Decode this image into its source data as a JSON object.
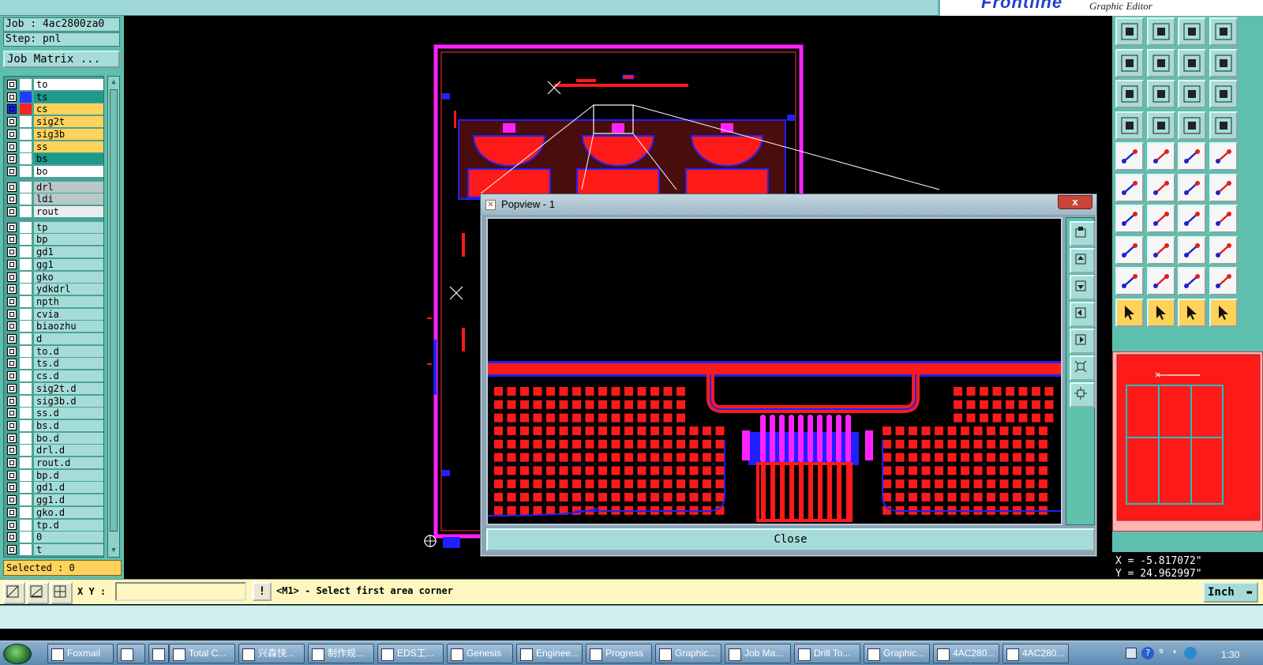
{
  "app": {
    "brand": "Frontline",
    "subtitle": "Graphic Editor"
  },
  "job": {
    "job_line": "Job : 4ac2800za0",
    "step_line": "Step: pnl",
    "matrix_button": "Job Matrix ..."
  },
  "layers": [
    {
      "name": "to",
      "bg": "#ffffff",
      "swatch": "#ffffff"
    },
    {
      "name": "ts",
      "bg": "#1d9a8c",
      "swatch": "#1f3cff"
    },
    {
      "name": "cs",
      "bg": "#ffd25c",
      "swatch": "#ff2020",
      "active": true
    },
    {
      "name": "sig2t",
      "bg": "#ffd25c",
      "swatch": "#ffffff"
    },
    {
      "name": "sig3b",
      "bg": "#ffd25c",
      "swatch": "#ffffff"
    },
    {
      "name": "ss",
      "bg": "#ffd25c",
      "swatch": "#ffffff"
    },
    {
      "name": "bs",
      "bg": "#1d9a8c",
      "swatch": "#ffffff"
    },
    {
      "name": "bo",
      "bg": "#ffffff",
      "swatch": "#ffffff"
    },
    {
      "name": "drl",
      "bg": "#b8c8c8",
      "swatch": "#ffffff",
      "gap": true
    },
    {
      "name": "ldi",
      "bg": "#b8c8c8",
      "swatch": "#ffffff"
    },
    {
      "name": "rout",
      "bg": "#e8eeee",
      "swatch": "#ffffff"
    },
    {
      "name": "tp",
      "bg": "#a6dcd8",
      "swatch": "#ffffff",
      "gap": true
    },
    {
      "name": "bp",
      "bg": "#a6dcd8",
      "swatch": "#ffffff"
    },
    {
      "name": "gd1",
      "bg": "#a6dcd8",
      "swatch": "#ffffff"
    },
    {
      "name": "gg1",
      "bg": "#a6dcd8",
      "swatch": "#ffffff"
    },
    {
      "name": "gko",
      "bg": "#a6dcd8",
      "swatch": "#ffffff"
    },
    {
      "name": "ydkdrl",
      "bg": "#a6dcd8",
      "swatch": "#ffffff"
    },
    {
      "name": "npth",
      "bg": "#a6dcd8",
      "swatch": "#ffffff"
    },
    {
      "name": "cvia",
      "bg": "#a6dcd8",
      "swatch": "#ffffff"
    },
    {
      "name": "biaozhu",
      "bg": "#a6dcd8",
      "swatch": "#ffffff"
    },
    {
      "name": "d",
      "bg": "#a6dcd8",
      "swatch": "#ffffff"
    },
    {
      "name": "to.d",
      "bg": "#a6dcd8",
      "swatch": "#ffffff"
    },
    {
      "name": "ts.d",
      "bg": "#a6dcd8",
      "swatch": "#ffffff"
    },
    {
      "name": "cs.d",
      "bg": "#a6dcd8",
      "swatch": "#ffffff"
    },
    {
      "name": "sig2t.d",
      "bg": "#a6dcd8",
      "swatch": "#ffffff"
    },
    {
      "name": "sig3b.d",
      "bg": "#a6dcd8",
      "swatch": "#ffffff"
    },
    {
      "name": "ss.d",
      "bg": "#a6dcd8",
      "swatch": "#ffffff"
    },
    {
      "name": "bs.d",
      "bg": "#a6dcd8",
      "swatch": "#ffffff"
    },
    {
      "name": "bo.d",
      "bg": "#a6dcd8",
      "swatch": "#ffffff"
    },
    {
      "name": "drl.d",
      "bg": "#a6dcd8",
      "swatch": "#ffffff"
    },
    {
      "name": "rout.d",
      "bg": "#a6dcd8",
      "swatch": "#ffffff"
    },
    {
      "name": "bp.d",
      "bg": "#a6dcd8",
      "swatch": "#ffffff"
    },
    {
      "name": "gd1.d",
      "bg": "#a6dcd8",
      "swatch": "#ffffff"
    },
    {
      "name": "gg1.d",
      "bg": "#a6dcd8",
      "swatch": "#ffffff"
    },
    {
      "name": "gko.d",
      "bg": "#a6dcd8",
      "swatch": "#ffffff"
    },
    {
      "name": "tp.d",
      "bg": "#a6dcd8",
      "swatch": "#ffffff"
    },
    {
      "name": "0",
      "bg": "#a6dcd8",
      "swatch": "#ffffff"
    },
    {
      "name": "t",
      "bg": "#a6dcd8",
      "swatch": "#ffffff"
    }
  ],
  "selected": "Selected : 0",
  "popview": {
    "title": "Popview - 1",
    "close_x": "x",
    "close_button": "Close"
  },
  "coords": {
    "x": "X = -5.817072\"",
    "y": "Y = 24.962997\""
  },
  "command": {
    "xy_label": "X Y :",
    "xy_value": "",
    "warn": "!",
    "prompt": "<M1> - Select first area corner",
    "units": "Inch"
  },
  "colors": {
    "background": "#000000",
    "panel_teal": "#5fbfaf",
    "feature_red": "#ff1a1a",
    "feature_blue": "#2020ff",
    "profile_magenta": "#ff22ff",
    "palette_yellow": "#ffd25c"
  },
  "taskbar": {
    "tasks": [
      {
        "label": "Foxmail",
        "icon": "foxmail-icon"
      },
      {
        "label": "",
        "icon": "app-icon"
      },
      {
        "label": "",
        "icon": "calculator-icon"
      },
      {
        "label": "Total C...",
        "icon": "total-commander-icon"
      },
      {
        "label": "兴森快...",
        "icon": "app-icon"
      },
      {
        "label": "制作规...",
        "icon": "document-icon"
      },
      {
        "label": "EDS工...",
        "icon": "frontline-icon"
      },
      {
        "label": "Genesis",
        "icon": "genesis-icon"
      },
      {
        "label": "Enginee...",
        "icon": "window-icon"
      },
      {
        "label": "Progress",
        "icon": "window-icon"
      },
      {
        "label": "Graphic...",
        "icon": "window-icon"
      },
      {
        "label": "Job Ma...",
        "icon": "window-icon"
      },
      {
        "label": "Drill To...",
        "icon": "window-icon"
      },
      {
        "label": "Graphic...",
        "icon": "window-icon"
      },
      {
        "label": "4AC280...",
        "icon": "excel-icon"
      },
      {
        "label": "4AC280...",
        "icon": "excel-icon"
      }
    ],
    "clock": "1:30"
  }
}
